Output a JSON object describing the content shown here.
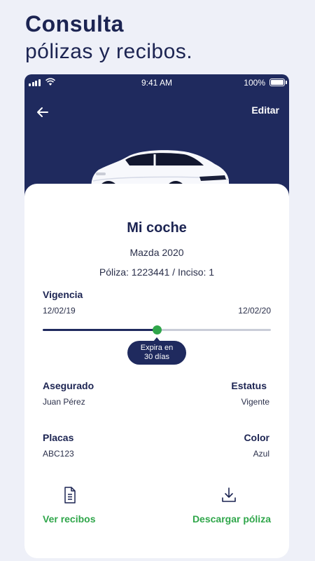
{
  "headline": {
    "line1": "Consulta",
    "line2": "pólizas y recibos."
  },
  "status_bar": {
    "time": "9:41 AM",
    "battery": "100%"
  },
  "header": {
    "edit_label": "Editar"
  },
  "vehicle": {
    "title": "Mi coche",
    "model": "Mazda 2020",
    "policy_line": "Póliza: 1223441  /  Inciso: 1"
  },
  "vigencia": {
    "label": "Vigencia",
    "start_date": "12/02/19",
    "end_date": "12/02/20",
    "progress": 0.5,
    "tooltip_line1": "Expira en",
    "tooltip_line2": "30 días"
  },
  "details": {
    "insured_label": "Asegurado",
    "insured_value": "Juan Pérez",
    "status_label": "Estatus",
    "status_value": "Vigente",
    "plates_label": "Placas",
    "plates_value": "ABC123",
    "color_label": "Color",
    "color_value": "Azul"
  },
  "actions": {
    "receipts_label": "Ver recibos",
    "receipts_icon": "document-icon",
    "download_label": "Descargar póliza",
    "download_icon": "download-icon"
  },
  "colors": {
    "navy": "#1f2a5e",
    "green": "#2fa64a",
    "background": "#eef0f8"
  }
}
